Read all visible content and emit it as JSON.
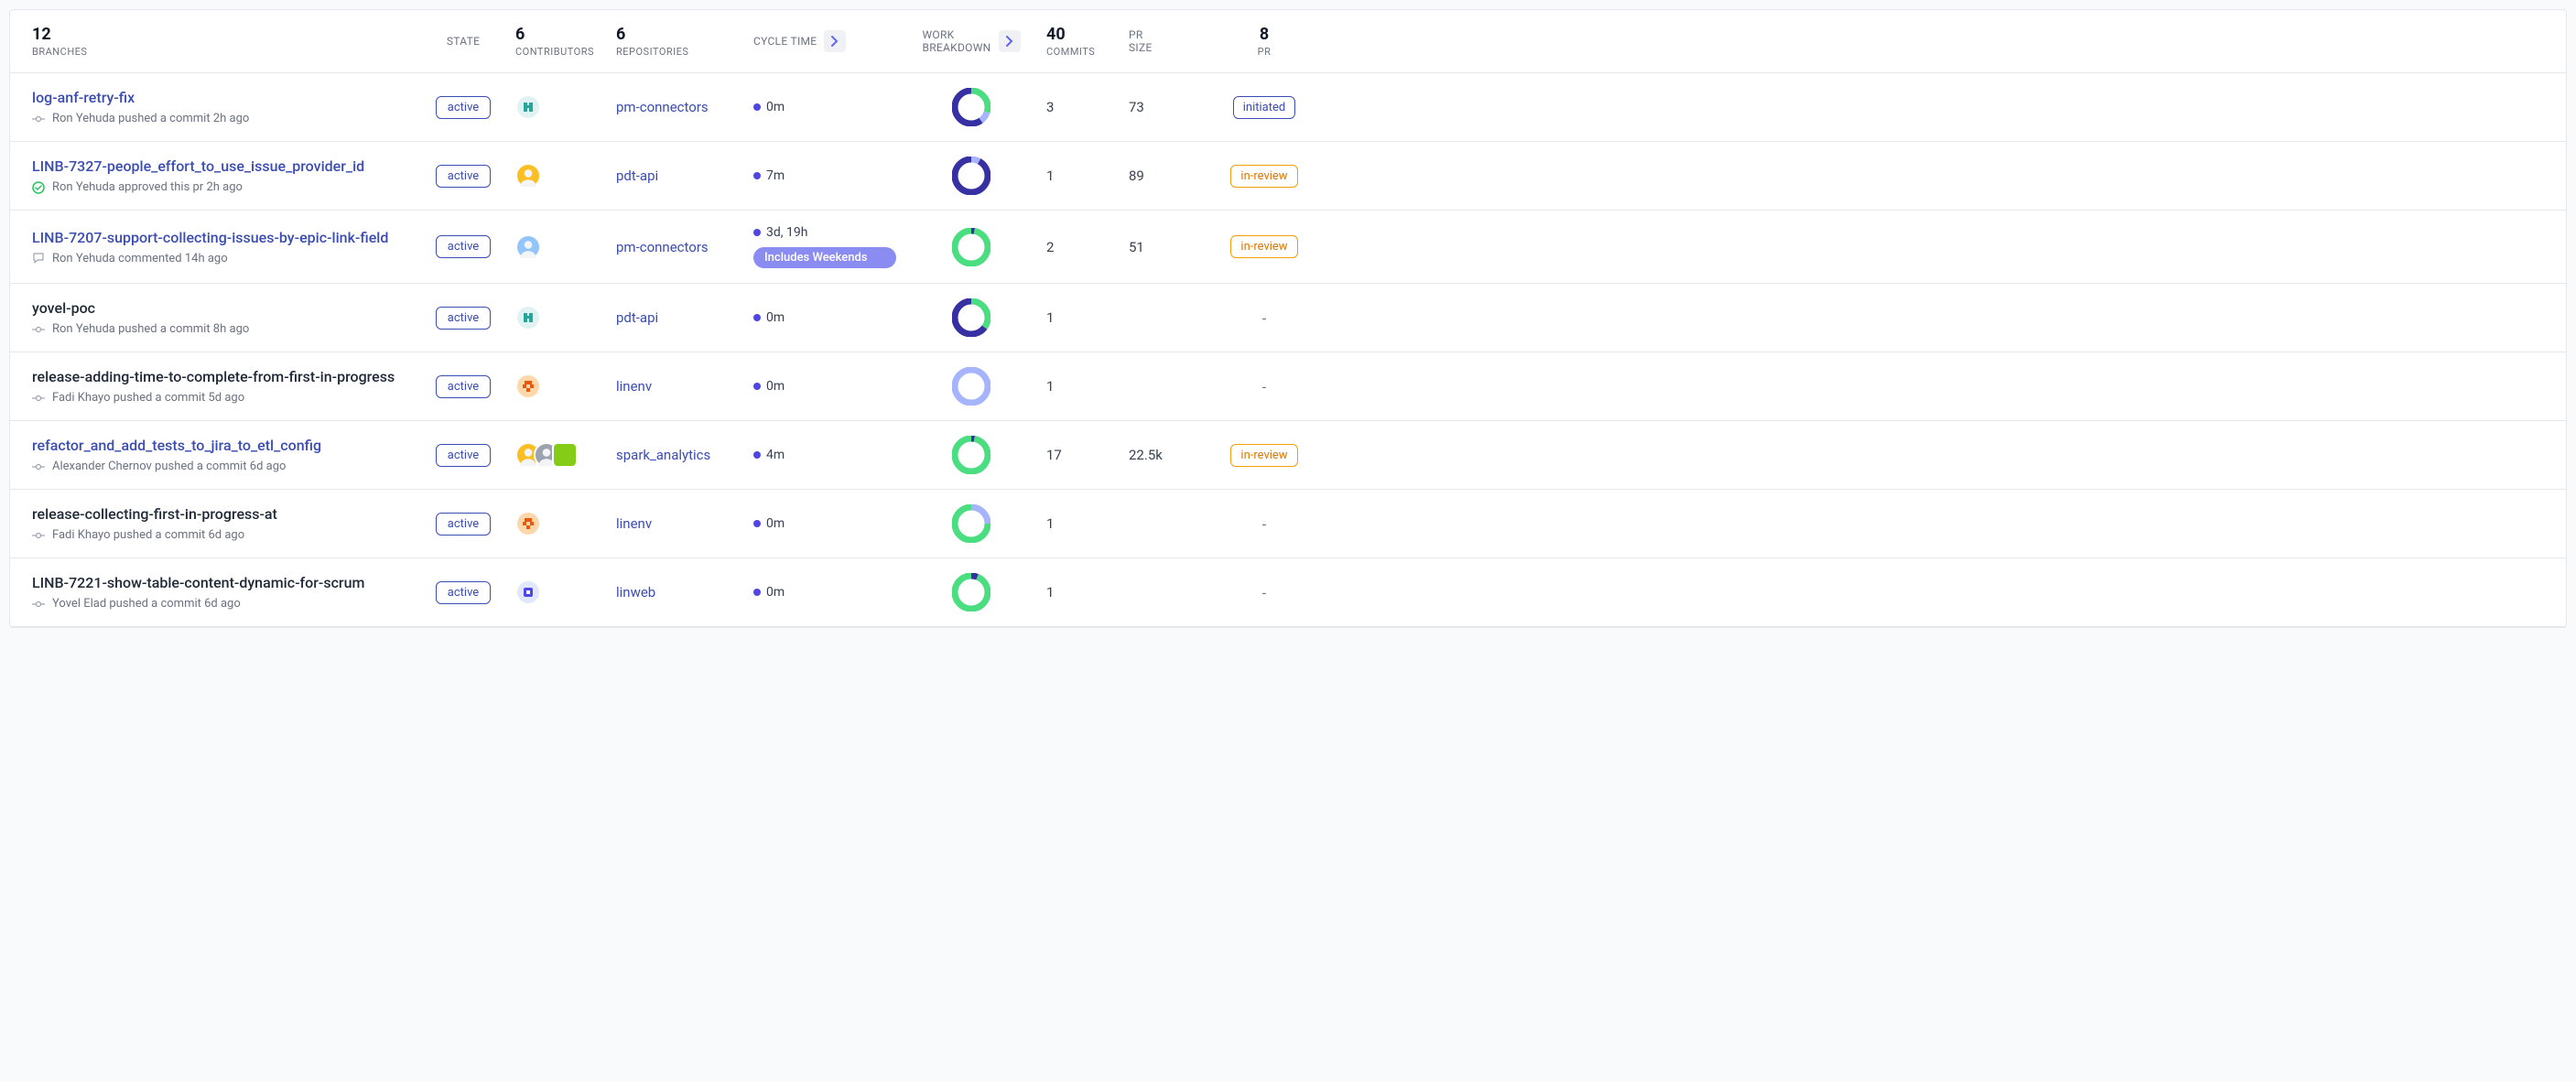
{
  "header": {
    "branches_count": "12",
    "branches_label": "BRANCHES",
    "state_label": "STATE",
    "contrib_count": "6",
    "contrib_label": "CONTRIBUTORS",
    "repo_count": "6",
    "repo_label": "REPOSITORIES",
    "cycle_label": "CYCLE TIME",
    "work_label1": "WORK",
    "work_label2": "BREAKDOWN",
    "commits_count": "40",
    "commits_label": "COMMITS",
    "prsize_label1": "PR",
    "prsize_label2": "SIZE",
    "pr_count": "8",
    "pr_label": "PR"
  },
  "rows": [
    {
      "branch": "log-anf-retry-fix",
      "link": true,
      "activity_icon": "commit",
      "activity": "Ron Yehuda pushed a commit 2h ago",
      "state": "active",
      "avatars": [
        {
          "type": "logo",
          "bg": "#e0f2f1",
          "fg": "#26a69a"
        }
      ],
      "repo": "pm-connectors",
      "cycle": "0m",
      "weekend": false,
      "donut": [
        {
          "c": "#4ade80",
          "p": 30
        },
        {
          "c": "#a5b4fc",
          "p": 10
        },
        {
          "c": "#3730a3",
          "p": 60
        }
      ],
      "commits": "3",
      "prsize": "73",
      "pr": "initiated"
    },
    {
      "branch": "LINB-7327-people_effort_to_use_issue_provider_id",
      "link": true,
      "activity_icon": "approve",
      "activity": "Ron Yehuda approved this pr 2h ago",
      "state": "active",
      "avatars": [
        {
          "type": "photo",
          "bg": "#fbbf24"
        }
      ],
      "repo": "pdt-api",
      "cycle": "7m",
      "weekend": false,
      "donut": [
        {
          "c": "#a5b4fc",
          "p": 8
        },
        {
          "c": "#3730a3",
          "p": 92
        }
      ],
      "commits": "1",
      "prsize": "89",
      "pr": "in-review"
    },
    {
      "branch": "LINB-7207-support-collecting-issues-by-epic-link-field",
      "link": true,
      "activity_icon": "comment",
      "activity": "Ron Yehuda commented 14h ago",
      "state": "active",
      "avatars": [
        {
          "type": "photo",
          "bg": "#93c5fd"
        }
      ],
      "repo": "pm-connectors",
      "cycle": "3d, 19h",
      "weekend": true,
      "weekend_text": "Includes Weekends",
      "donut": [
        {
          "c": "#3730a3",
          "p": 3
        },
        {
          "c": "#4ade80",
          "p": 97
        }
      ],
      "commits": "2",
      "prsize": "51",
      "pr": "in-review"
    },
    {
      "branch": "yovel-poc",
      "link": false,
      "activity_icon": "commit",
      "activity": "Ron Yehuda pushed a commit 8h ago",
      "state": "active",
      "avatars": [
        {
          "type": "logo",
          "bg": "#e0f2f1",
          "fg": "#26a69a"
        }
      ],
      "repo": "pdt-api",
      "cycle": "0m",
      "weekend": false,
      "donut": [
        {
          "c": "#4ade80",
          "p": 35
        },
        {
          "c": "#3730a3",
          "p": 65
        }
      ],
      "commits": "1",
      "prsize": "",
      "pr": "-"
    },
    {
      "branch": "release-adding-time-to-complete-from-first-in-progress",
      "link": false,
      "activity_icon": "commit",
      "activity": "Fadi Khayo pushed a commit 5d ago",
      "state": "active",
      "avatars": [
        {
          "type": "pixel",
          "bg": "#fed7aa",
          "fg": "#ea580c"
        }
      ],
      "repo": "linenv",
      "cycle": "0m",
      "weekend": false,
      "donut": [
        {
          "c": "#a5b4fc",
          "p": 100
        }
      ],
      "commits": "1",
      "prsize": "",
      "pr": "-"
    },
    {
      "branch": "refactor_and_add_tests_to_jira_to_etl_config",
      "link": true,
      "activity_icon": "commit",
      "activity": "Alexander Chernov pushed a commit 6d ago",
      "state": "active",
      "avatars": [
        {
          "type": "photo",
          "bg": "#fbbf24"
        },
        {
          "type": "photo",
          "bg": "#9ca3af"
        },
        {
          "type": "square",
          "bg": "#84cc16"
        }
      ],
      "repo": "spark_analytics",
      "cycle": "4m",
      "weekend": false,
      "donut": [
        {
          "c": "#3730a3",
          "p": 3
        },
        {
          "c": "#4ade80",
          "p": 97
        }
      ],
      "commits": "17",
      "prsize": "22.5k",
      "pr": "in-review"
    },
    {
      "branch": "release-collecting-first-in-progress-at",
      "link": false,
      "activity_icon": "commit",
      "activity": "Fadi Khayo pushed a commit 6d ago",
      "state": "active",
      "avatars": [
        {
          "type": "pixel",
          "bg": "#fed7aa",
          "fg": "#ea580c"
        }
      ],
      "repo": "linenv",
      "cycle": "0m",
      "weekend": false,
      "donut": [
        {
          "c": "#a5b4fc",
          "p": 25
        },
        {
          "c": "#4ade80",
          "p": 75
        }
      ],
      "commits": "1",
      "prsize": "",
      "pr": "-"
    },
    {
      "branch": "LINB-7221-show-table-content-dynamic-for-scrum",
      "link": false,
      "activity_icon": "commit",
      "activity": "Yovel Elad pushed a commit 6d ago",
      "state": "active",
      "avatars": [
        {
          "type": "logo2",
          "bg": "#e0e7ff",
          "fg": "#4f46e5"
        }
      ],
      "repo": "linweb",
      "cycle": "0m",
      "weekend": false,
      "donut": [
        {
          "c": "#3730a3",
          "p": 6
        },
        {
          "c": "#4ade80",
          "p": 94
        }
      ],
      "commits": "1",
      "prsize": "",
      "pr": "-"
    }
  ]
}
